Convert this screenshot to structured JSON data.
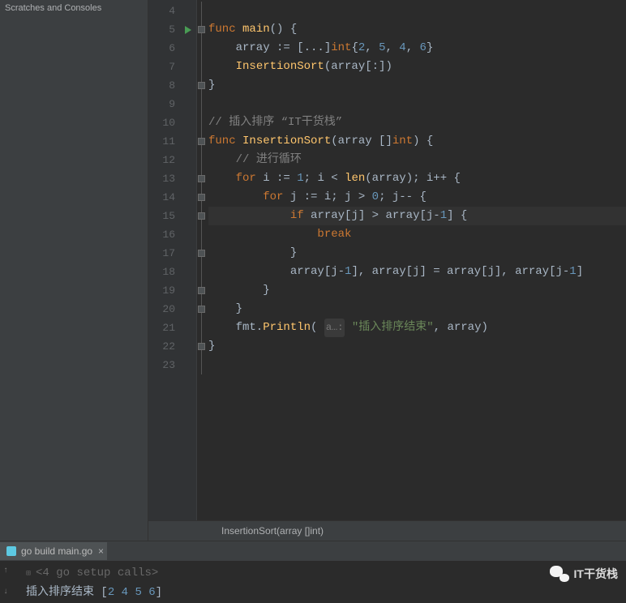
{
  "sidebar": {
    "label": "Scratches and Consoles"
  },
  "gutter": {
    "lines": [
      "4",
      "5",
      "6",
      "7",
      "8",
      "9",
      "10",
      "11",
      "12",
      "13",
      "14",
      "15",
      "16",
      "17",
      "18",
      "19",
      "20",
      "21",
      "22",
      "23"
    ],
    "run_at": 5,
    "highlight_at": 15
  },
  "code": {
    "lines": [
      {
        "n": 4,
        "tokens": []
      },
      {
        "n": 5,
        "tokens": [
          {
            "t": "k",
            "v": "func "
          },
          {
            "t": "fn",
            "v": "main"
          },
          {
            "t": "p",
            "v": "() {"
          }
        ]
      },
      {
        "n": 6,
        "tokens": [
          {
            "t": "p",
            "v": "    array := [..."
          },
          {
            "t": "p",
            "v": "]"
          },
          {
            "t": "k",
            "v": "int"
          },
          {
            "t": "p",
            "v": "{"
          },
          {
            "t": "n",
            "v": "2"
          },
          {
            "t": "p",
            "v": ", "
          },
          {
            "t": "n",
            "v": "5"
          },
          {
            "t": "p",
            "v": ", "
          },
          {
            "t": "n",
            "v": "4"
          },
          {
            "t": "p",
            "v": ", "
          },
          {
            "t": "n",
            "v": "6"
          },
          {
            "t": "p",
            "v": "}"
          }
        ]
      },
      {
        "n": 7,
        "tokens": [
          {
            "t": "p",
            "v": "    "
          },
          {
            "t": "fn",
            "v": "InsertionSort"
          },
          {
            "t": "p",
            "v": "(array[:])"
          }
        ]
      },
      {
        "n": 8,
        "tokens": [
          {
            "t": "p",
            "v": "}"
          }
        ]
      },
      {
        "n": 9,
        "tokens": []
      },
      {
        "n": 10,
        "tokens": [
          {
            "t": "c",
            "v": "// 插入排序 “IT干货栈”"
          }
        ]
      },
      {
        "n": 11,
        "tokens": [
          {
            "t": "k",
            "v": "func "
          },
          {
            "t": "fn",
            "v": "InsertionSort"
          },
          {
            "t": "p",
            "v": "(array []"
          },
          {
            "t": "k",
            "v": "int"
          },
          {
            "t": "p",
            "v": ") {"
          }
        ]
      },
      {
        "n": 12,
        "tokens": [
          {
            "t": "p",
            "v": "    "
          },
          {
            "t": "c",
            "v": "// 进行循环"
          }
        ]
      },
      {
        "n": 13,
        "tokens": [
          {
            "t": "p",
            "v": "    "
          },
          {
            "t": "k",
            "v": "for "
          },
          {
            "t": "p",
            "v": "i := "
          },
          {
            "t": "n",
            "v": "1"
          },
          {
            "t": "p",
            "v": "; i < "
          },
          {
            "t": "fn",
            "v": "len"
          },
          {
            "t": "p",
            "v": "(array); i++ {"
          }
        ]
      },
      {
        "n": 14,
        "tokens": [
          {
            "t": "p",
            "v": "        "
          },
          {
            "t": "k",
            "v": "for "
          },
          {
            "t": "p",
            "v": "j := i; j > "
          },
          {
            "t": "n",
            "v": "0"
          },
          {
            "t": "p",
            "v": "; j-- {"
          }
        ]
      },
      {
        "n": 15,
        "tokens": [
          {
            "t": "p",
            "v": "            "
          },
          {
            "t": "k",
            "v": "if "
          },
          {
            "t": "p",
            "v": "array[j] > array[j-"
          },
          {
            "t": "n",
            "v": "1"
          },
          {
            "t": "p",
            "v": "] {"
          }
        ]
      },
      {
        "n": 16,
        "tokens": [
          {
            "t": "p",
            "v": "                "
          },
          {
            "t": "k",
            "v": "break"
          }
        ]
      },
      {
        "n": 17,
        "tokens": [
          {
            "t": "p",
            "v": "            }"
          }
        ]
      },
      {
        "n": 18,
        "tokens": [
          {
            "t": "p",
            "v": "            array[j-"
          },
          {
            "t": "n",
            "v": "1"
          },
          {
            "t": "p",
            "v": "], array[j] = array[j], array[j-"
          },
          {
            "t": "n",
            "v": "1"
          },
          {
            "t": "p",
            "v": "]"
          }
        ]
      },
      {
        "n": 19,
        "tokens": [
          {
            "t": "p",
            "v": "        }"
          }
        ]
      },
      {
        "n": 20,
        "tokens": [
          {
            "t": "p",
            "v": "    }"
          }
        ]
      },
      {
        "n": 21,
        "tokens": [
          {
            "t": "p",
            "v": "    fmt."
          },
          {
            "t": "fn",
            "v": "Println"
          },
          {
            "t": "p",
            "v": "( "
          },
          {
            "t": "hint",
            "v": "a…:"
          },
          {
            "t": "p",
            "v": " "
          },
          {
            "t": "s",
            "v": "\"插入排序结束\""
          },
          {
            "t": "p",
            "v": ", array)"
          }
        ]
      },
      {
        "n": 22,
        "tokens": [
          {
            "t": "p",
            "v": "}"
          }
        ]
      },
      {
        "n": 23,
        "tokens": []
      }
    ]
  },
  "breadcrumb": {
    "text": "InsertionSort(array []int)"
  },
  "run": {
    "tab_label": "go build main.go",
    "setup_line": "<4 go setup calls>",
    "output_prefix": "插入排序结束 [",
    "output_values": [
      "2",
      "4",
      "5",
      "6"
    ],
    "output_suffix": "]"
  },
  "watermark": {
    "text": "IT干货栈"
  }
}
